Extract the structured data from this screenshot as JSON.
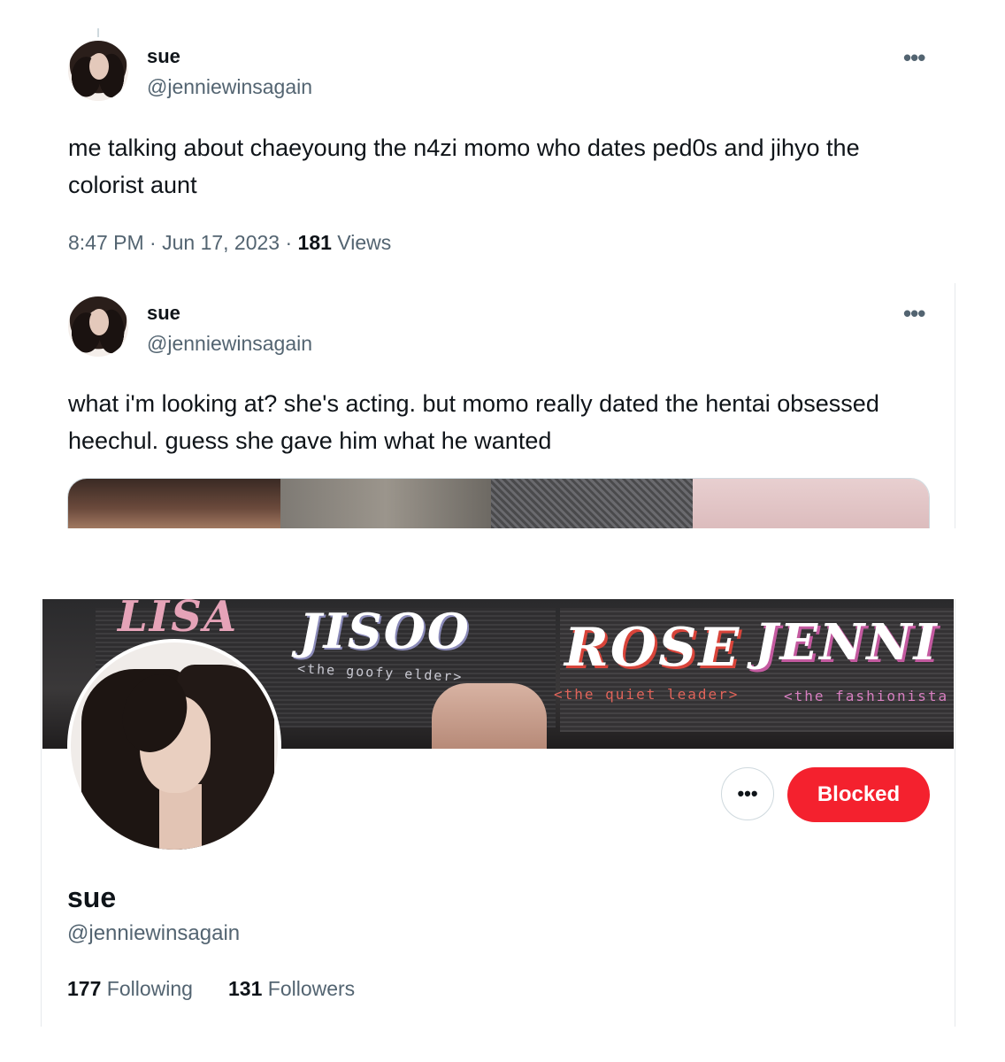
{
  "tweet1": {
    "name": "sue",
    "handle": "@jenniewinsagain",
    "more": "•••",
    "text": "me talking about chaeyoung the n4zi momo who dates ped0s and jihyo the colorist aunt",
    "time": "8:47 PM · Jun 17, 2023 · ",
    "views_count": "181",
    "views_label": " Views"
  },
  "tweet2": {
    "name": "sue",
    "handle": "@jenniewinsagain",
    "more": "•••",
    "text": "what i'm looking at? she's acting. but momo really dated the hentai obsessed heechul. guess she gave him what he wanted"
  },
  "profile": {
    "banner": {
      "lisa": "LISA",
      "jisoo": "JISOO",
      "jisoo_sub": "<the goofy elder>",
      "rose": "ROSE",
      "rose_sub": "<the quiet leader>",
      "jennie": "JENNI",
      "jennie_sub": "<the fashionista"
    },
    "more": "•••",
    "blocked_label": "Blocked",
    "name": "sue",
    "handle": "@jenniewinsagain",
    "following_count": "177",
    "following_label": " Following",
    "followers_count": "131",
    "followers_label": " Followers"
  },
  "colors": {
    "blocked": "#f4212e",
    "secondary_text": "#536471",
    "primary_text": "#0f1419"
  }
}
